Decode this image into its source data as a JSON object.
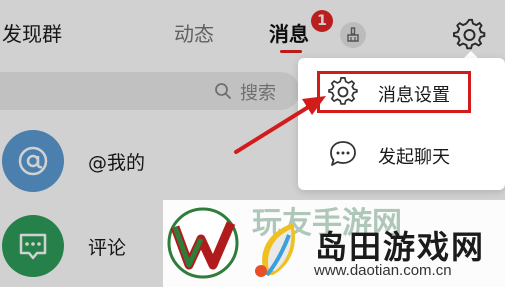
{
  "header": {
    "tabs": [
      {
        "label": "发现群"
      },
      {
        "label": "动态"
      },
      {
        "label": "消息"
      }
    ],
    "active_tab": "消息",
    "unread_badge": "1",
    "icons": [
      "broom-icon",
      "gear-icon"
    ]
  },
  "search": {
    "placeholder": "搜索"
  },
  "list": {
    "items": [
      {
        "title": "@我的",
        "icon": "at-icon"
      },
      {
        "title": "评论",
        "icon": "comment-icon"
      }
    ]
  },
  "popup_menu": {
    "items": [
      {
        "label": "消息设置",
        "icon": "gear-icon",
        "highlighted": true
      },
      {
        "label": "发起聊天",
        "icon": "chat-bubble-icon"
      }
    ]
  },
  "watermark": {
    "name": "岛田游戏网",
    "url": "www.daotian.com.cn",
    "ghost_text": "玩友手游网"
  },
  "colors": {
    "accent_red": "#e32727",
    "annotation_red": "#d21c1c",
    "at_avatar": "#5b9bd5",
    "comment_avatar": "#2e9e59"
  }
}
